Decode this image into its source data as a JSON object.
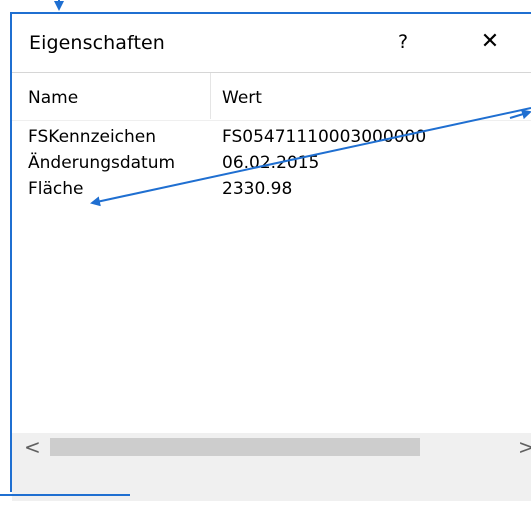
{
  "dialog": {
    "title": "Eigenschaften",
    "help_label": "?",
    "close_label": "✕"
  },
  "table": {
    "headers": {
      "name": "Name",
      "value": "Wert"
    },
    "rows": [
      {
        "name": "FSKennzeichen",
        "value": "FS05471110003000000"
      },
      {
        "name": "Änderungsdatum",
        "value": "06.02.2015"
      },
      {
        "name": "Fläche",
        "value": "2330.98"
      }
    ]
  },
  "scrollbar": {
    "left_arrow": "<",
    "right_arrow": ">"
  },
  "annotation": {
    "color": "#1f6fd1"
  }
}
